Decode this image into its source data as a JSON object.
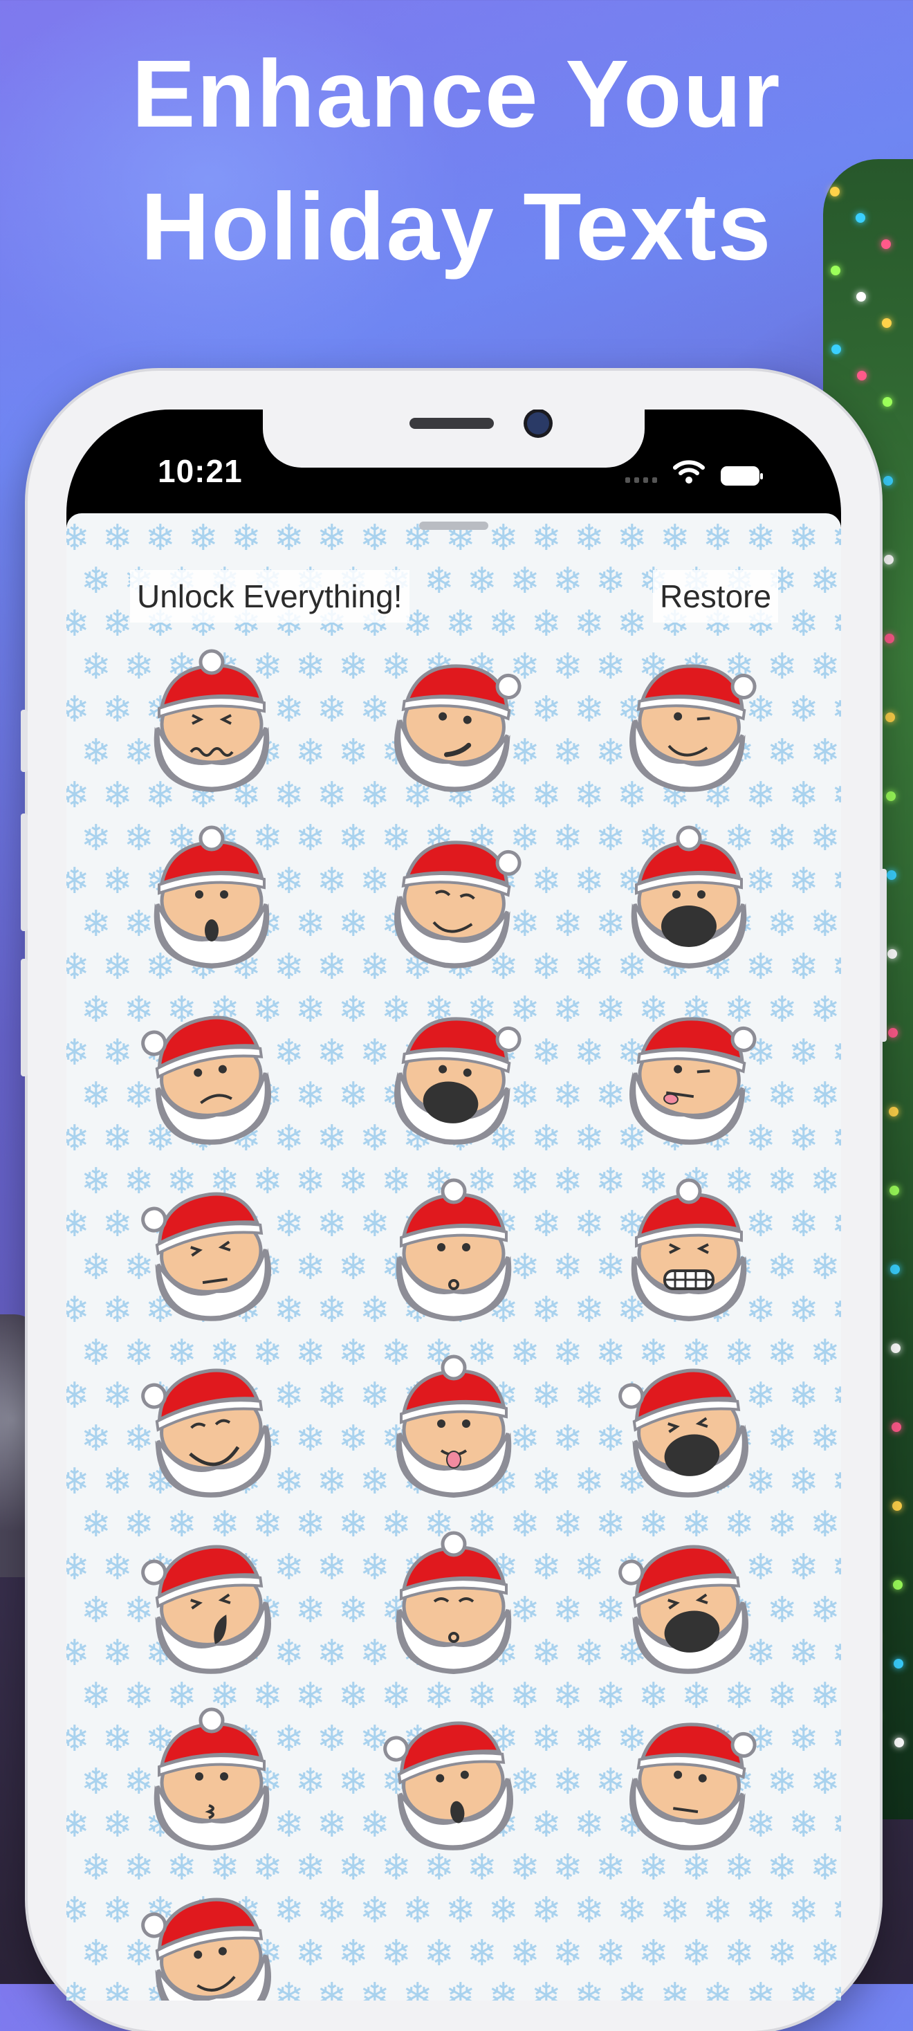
{
  "headline": {
    "line1": "Enhance Your",
    "line2": "Holiday Texts"
  },
  "status_bar": {
    "time": "10:21"
  },
  "toolbar": {
    "unlock_label": "Unlock Everything!",
    "restore_label": "Restore"
  },
  "stickers": [
    {
      "name": "santa-grimace-sticker",
      "mouth": "wavy",
      "eyes": "squint",
      "tilt": "front"
    },
    {
      "name": "santa-smirk-sticker",
      "mouth": "smirk",
      "eyes": "dots",
      "tilt": "right"
    },
    {
      "name": "santa-wink-sticker",
      "mouth": "smile",
      "eyes": "wink",
      "tilt": "right"
    },
    {
      "name": "santa-surprised-sticker",
      "mouth": "o",
      "eyes": "dots",
      "tilt": "front"
    },
    {
      "name": "santa-smug-sticker",
      "mouth": "smile",
      "eyes": "closed",
      "tilt": "right"
    },
    {
      "name": "santa-shouting-sticker",
      "mouth": "open",
      "eyes": "dots",
      "tilt": "front"
    },
    {
      "name": "santa-frown-sticker",
      "mouth": "frown",
      "eyes": "dots",
      "tilt": "left"
    },
    {
      "name": "santa-yell-sticker",
      "mouth": "open",
      "eyes": "dots",
      "tilt": "right"
    },
    {
      "name": "santa-silly-sticker",
      "mouth": "tongue-side",
      "eyes": "wink",
      "tilt": "right"
    },
    {
      "name": "santa-annoyed-sticker",
      "mouth": "flat",
      "eyes": "squint",
      "tilt": "left"
    },
    {
      "name": "santa-whistle-sticker",
      "mouth": "small-o",
      "eyes": "dots",
      "tilt": "front"
    },
    {
      "name": "santa-gritted-teeth-sticker",
      "mouth": "teeth",
      "eyes": "squint",
      "tilt": "front"
    },
    {
      "name": "santa-laugh-sticker",
      "mouth": "big-smile",
      "eyes": "closed",
      "tilt": "left"
    },
    {
      "name": "santa-tongue-sticker",
      "mouth": "tongue",
      "eyes": "dots",
      "tilt": "front"
    },
    {
      "name": "santa-lol-sticker",
      "mouth": "open",
      "eyes": "squint",
      "tilt": "left"
    },
    {
      "name": "santa-cry-sticker",
      "mouth": "side-open",
      "eyes": "squint",
      "tilt": "left"
    },
    {
      "name": "santa-sleepy-sticker",
      "mouth": "small-o",
      "eyes": "closed",
      "tilt": "front"
    },
    {
      "name": "santa-roar-sticker",
      "mouth": "open",
      "eyes": "squint",
      "tilt": "left"
    },
    {
      "name": "santa-kiss-sticker",
      "mouth": "kiss",
      "eyes": "dots",
      "tilt": "front"
    },
    {
      "name": "santa-shock-sticker",
      "mouth": "o",
      "eyes": "dots",
      "tilt": "left"
    },
    {
      "name": "santa-neutral-sticker",
      "mouth": "flat",
      "eyes": "dots",
      "tilt": "right"
    },
    {
      "name": "santa-partial-sticker",
      "mouth": "smile",
      "eyes": "dots",
      "tilt": "left"
    }
  ],
  "colors": {
    "hat_red": "#e0191e",
    "skin": "#f4c59a",
    "outline": "#8d8d96",
    "snowflake": "#a9d2ee"
  },
  "icons": [
    "wifi-icon",
    "battery-icon",
    "cellular-signal-icon",
    "snowflake-icon"
  ]
}
